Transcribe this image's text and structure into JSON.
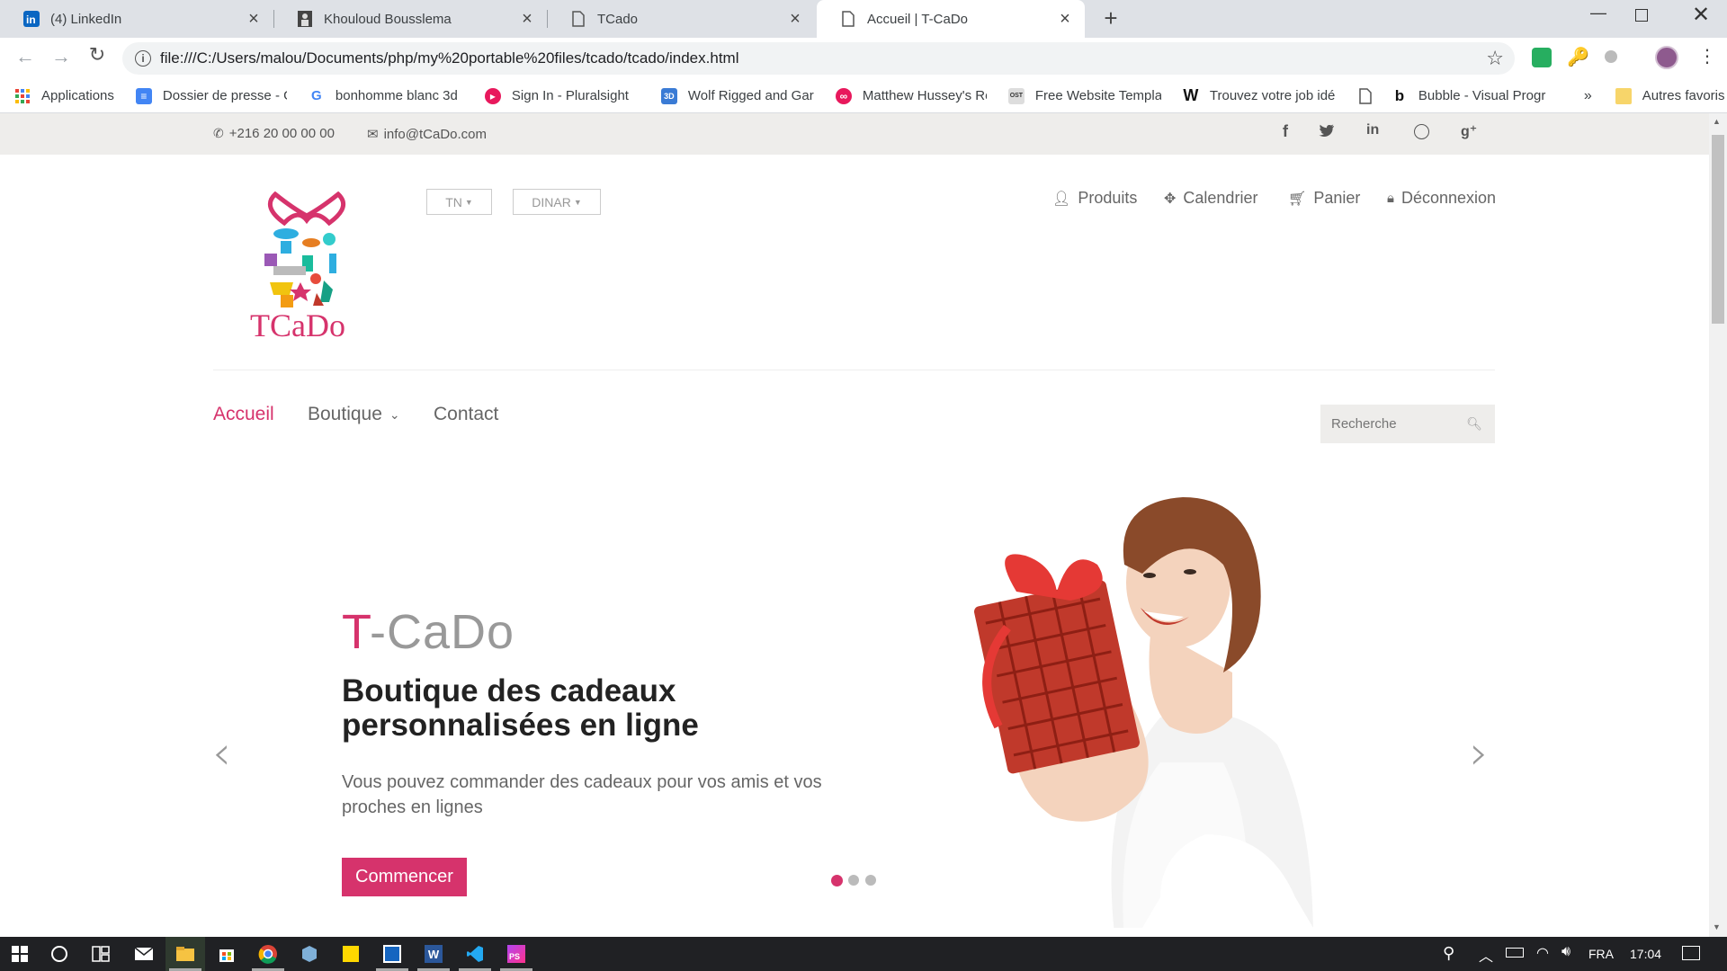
{
  "browser": {
    "tabs": [
      {
        "title": "(4) LinkedIn",
        "icon": "linkedin-icon"
      },
      {
        "title": "Khouloud Bousslema",
        "icon": "profile-icon"
      },
      {
        "title": "TCado",
        "icon": "page-icon"
      },
      {
        "title": "Accueil | T-CaDo",
        "icon": "page-icon",
        "active": true
      }
    ],
    "url": "file:///C:/Users/malou/Documents/php/my%20portable%20files/tcado/tcado/index.html",
    "bookmarks": [
      {
        "label": "Applications",
        "icon": "apps-grid-icon"
      },
      {
        "label": "Dossier de presse - G",
        "icon": "google-docs-icon"
      },
      {
        "label": "bonhomme blanc 3d",
        "icon": "google-icon"
      },
      {
        "label": "Sign In - Pluralsight",
        "icon": "pluralsight-icon"
      },
      {
        "label": "Wolf Rigged and Gar",
        "icon": "3d-icon"
      },
      {
        "label": "Matthew Hussey's Re",
        "icon": "matthew-hussey-icon"
      },
      {
        "label": "Free Website Templat",
        "icon": "ost-icon"
      },
      {
        "label": "Trouvez votre job idé",
        "icon": "w-icon"
      },
      {
        "label": "",
        "icon": "page-icon"
      },
      {
        "label": "Bubble - Visual Progr",
        "icon": "bubble-icon"
      }
    ],
    "more_bookmarks": "»",
    "other_bookmarks": "Autres favoris"
  },
  "site": {
    "phone": "+216 20 00 00 00",
    "email": "info@tCaDo.com",
    "social": [
      "facebook-icon",
      "twitter-icon",
      "linkedin-icon",
      "dribbble-icon",
      "google-plus-icon"
    ],
    "logo_text": "TCaDo",
    "lang_select": "TN",
    "currency_select": "DINAR",
    "header_links": [
      {
        "label": "Produits",
        "icon": "user-icon"
      },
      {
        "label": "Calendrier",
        "icon": "crosshair-icon"
      },
      {
        "label": "Panier",
        "icon": "cart-icon"
      },
      {
        "label": "Déconnexion",
        "icon": "lock-icon"
      }
    ],
    "main_nav": {
      "home": "Accueil",
      "shop": "Boutique",
      "contact": "Contact"
    },
    "search_placeholder": "Recherche",
    "slider": {
      "brand_first": "T",
      "brand_rest": "-CaDo",
      "headline": "Boutique des cadeaux personnalisées en ligne",
      "text": "Vous pouvez commander des cadeaux pour vos amis et vos proches en lignes",
      "button": "Commencer",
      "active_slide": 1,
      "slide_count": 3
    },
    "accent_color": "#d6336c"
  },
  "taskbar": {
    "lang": "FRA",
    "time": "17:04"
  }
}
